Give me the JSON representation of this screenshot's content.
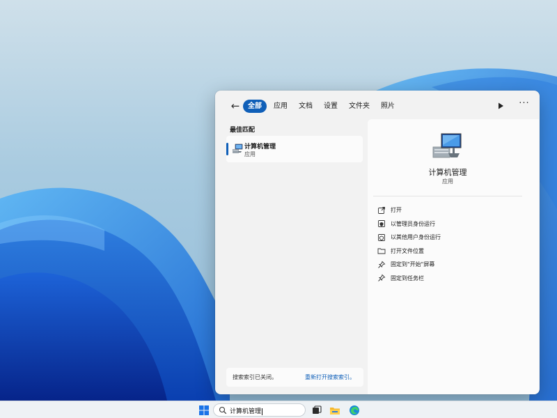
{
  "filters": {
    "tabs": [
      {
        "label": "全部",
        "active": true
      },
      {
        "label": "应用"
      },
      {
        "label": "文档"
      },
      {
        "label": "设置"
      },
      {
        "label": "文件夹"
      },
      {
        "label": "照片"
      }
    ],
    "more_label": "···"
  },
  "results": {
    "section_title": "最佳匹配",
    "best_match": {
      "name": "计算机管理",
      "type": "应用"
    },
    "index_notice": {
      "message": "搜索索引已关闭。",
      "link": "重新打开搜索索引。"
    }
  },
  "detail": {
    "title": "计算机管理",
    "subtitle": "应用",
    "actions": [
      {
        "label": "打开",
        "icon": "open-icon"
      },
      {
        "label": "以管理员身份运行",
        "icon": "shield-icon"
      },
      {
        "label": "以其他用户身份运行",
        "icon": "user-shield-icon"
      },
      {
        "label": "打开文件位置",
        "icon": "folder-icon"
      },
      {
        "label": "固定到\"开始\"屏幕",
        "icon": "pin-icon"
      },
      {
        "label": "固定到任务栏",
        "icon": "pin-icon"
      }
    ]
  },
  "taskbar": {
    "search_query": "计算机管理"
  },
  "colors": {
    "accent": "#0f5fb8",
    "panel_bg": "#f2f2f2",
    "pane_bg": "#fbfbfb"
  }
}
